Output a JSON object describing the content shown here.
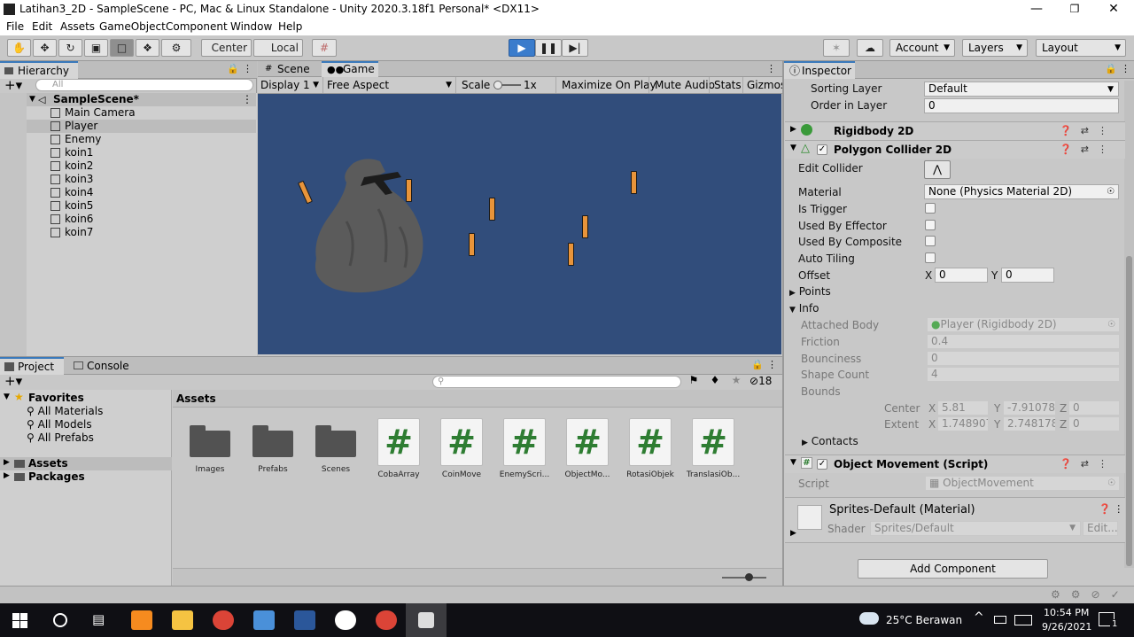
{
  "window": {
    "title": "Latihan3_2D - SampleScene - PC, Mac & Linux Standalone - Unity 2020.3.18f1 Personal* <DX11>",
    "minimize": "—",
    "restore": "❐",
    "close": "✕"
  },
  "menu": [
    "File",
    "Edit",
    "Assets",
    "GameObject",
    "Component",
    "Window",
    "Help"
  ],
  "toolbar": {
    "pivot_center": "Center",
    "pivot_local": "Local",
    "account": "Account",
    "layers": "Layers",
    "layout": "Layout"
  },
  "hierarchy": {
    "tab": "Hierarchy",
    "search_placeholder": "All",
    "scene": "SampleScene*",
    "items": [
      "Main Camera",
      "Player",
      "Enemy",
      "koin1",
      "koin2",
      "koin3",
      "koin4",
      "koin5",
      "koin6",
      "koin7"
    ],
    "selected": "Player"
  },
  "game": {
    "tabs": [
      "Scene",
      "Game"
    ],
    "display": "Display 1",
    "aspect": "Free Aspect",
    "scale_label": "Scale",
    "scale_value": "1x",
    "maximize": "Maximize On Play",
    "mute": "Mute Audio",
    "stats": "Stats",
    "gizmos": "Gizmos",
    "bg_color": "#314d7b",
    "coin_color": "#e8943a"
  },
  "project": {
    "tabs": [
      "Project",
      "Console"
    ],
    "favorites": "Favorites",
    "fav_items": [
      "All Materials",
      "All Models",
      "All Prefabs"
    ],
    "roots": [
      "Assets",
      "Packages"
    ],
    "breadcrumb": "Assets",
    "count": "18",
    "assets": [
      {
        "name": "Images",
        "kind": "folder"
      },
      {
        "name": "Prefabs",
        "kind": "folder"
      },
      {
        "name": "Scenes",
        "kind": "folder"
      },
      {
        "name": "CobaArray",
        "kind": "script"
      },
      {
        "name": "CoinMove",
        "kind": "script"
      },
      {
        "name": "EnemyScri...",
        "kind": "script"
      },
      {
        "name": "ObjectMo...",
        "kind": "script"
      },
      {
        "name": "RotasiObjek",
        "kind": "script"
      },
      {
        "name": "TranslasiOb...",
        "kind": "script"
      }
    ]
  },
  "inspector": {
    "tab": "Inspector",
    "sorting_layer_label": "Sorting Layer",
    "sorting_layer_value": "Default",
    "order_label": "Order in Layer",
    "order_value": "0",
    "rigidbody": "Rigidbody 2D",
    "collider": "Polygon Collider 2D",
    "edit_collider": "Edit Collider",
    "material_label": "Material",
    "material_value": "None (Physics Material 2D)",
    "is_trigger": "Is Trigger",
    "used_by_effector": "Used By Effector",
    "used_by_composite": "Used By Composite",
    "auto_tiling": "Auto Tiling",
    "offset_label": "Offset",
    "offset_x_label": "X",
    "offset_x": "0",
    "offset_y_label": "Y",
    "offset_y": "0",
    "points": "Points",
    "info": "Info",
    "attached_body_label": "Attached Body",
    "attached_body": "Player (Rigidbody 2D)",
    "friction_label": "Friction",
    "friction": "0.4",
    "bounciness_label": "Bounciness",
    "bounciness": "0",
    "shape_count_label": "Shape Count",
    "shape_count": "4",
    "bounds_label": "Bounds",
    "center_label": "Center",
    "center_x": "5.81",
    "center_y": "-7.910783",
    "center_z": "0",
    "extent_label": "Extent",
    "extent_x": "1.748907",
    "extent_y": "2.748178",
    "extent_z": "0",
    "x": "X",
    "y": "Y",
    "z": "Z",
    "contacts": "Contacts",
    "script_component": "Object Movement (Script)",
    "script_label": "Script",
    "script_value": "ObjectMovement",
    "material_block": "Sprites-Default (Material)",
    "shader_label": "Shader",
    "shader_value": "Sprites/Default",
    "edit_label": "Edit...",
    "add_component": "Add Component"
  },
  "taskbar": {
    "weather": "25°C  Berawan",
    "time": "10:54 PM",
    "date": "9/26/2021",
    "notif": "1"
  }
}
